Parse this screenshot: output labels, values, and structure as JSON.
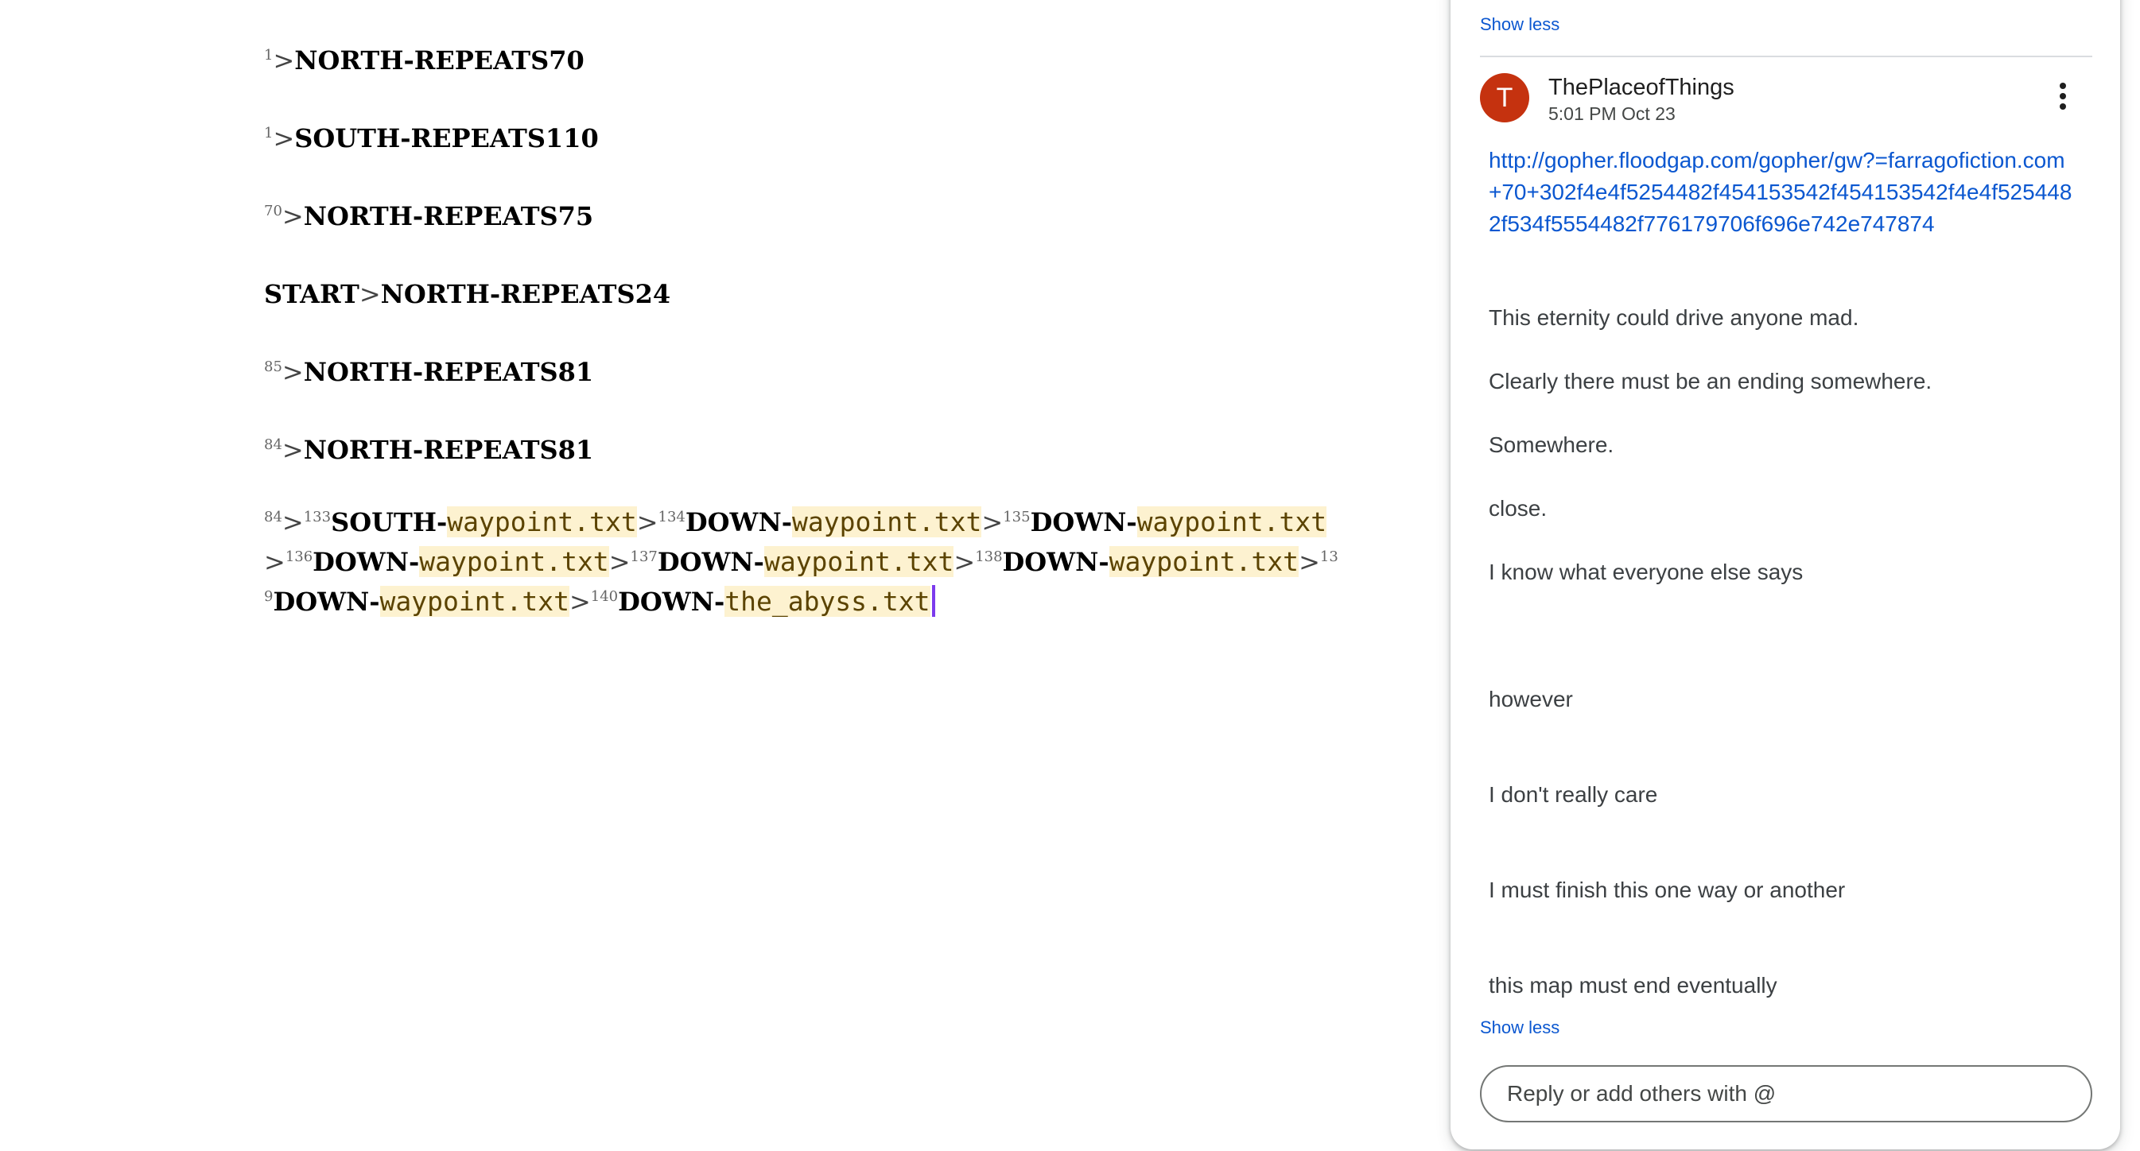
{
  "document": {
    "lines": [
      {
        "sup": "1",
        "gt": ">",
        "text": "NORTH-REPEATS70"
      },
      {
        "sup": "1",
        "gt": ">",
        "text": "SOUTH-REPEATS110"
      },
      {
        "sup": "70",
        "gt": ">",
        "text": "NORTH-REPEATS75"
      },
      {
        "prefix": "START",
        "gt": ">",
        "text": "NORTH-REPEATS24"
      },
      {
        "sup": "85",
        "gt": ">",
        "text": "NORTH-REPEATS81"
      },
      {
        "sup": "84",
        "gt": ">",
        "text": "NORTH-REPEATS81"
      }
    ],
    "waypoint_block": {
      "s84": "84",
      "s133": "133",
      "dir133": "SOUTH-",
      "f133": "waypoint.txt",
      "s134": "134",
      "dir134": "DOWN-",
      "f134": "waypoint.txt",
      "s135": "135",
      "dir135": "DOWN-",
      "f135": "waypoint.txt",
      "s136": "136",
      "dir136": "DOWN-",
      "f136": "waypoint.txt",
      "s137": "137",
      "dir137": "DOWN-",
      "f137": "waypoint.txt",
      "s138": "138",
      "dir138": "DOWN-",
      "f138": "waypoint.txt",
      "s139a": "13",
      "s139b": "9",
      "dir139": "DOWN-",
      "f139": "waypoint.txt",
      "s140": "140",
      "dir140": "DOWN-",
      "f140": "the_abyss.txt",
      "gt": ">"
    }
  },
  "comments": {
    "show_less_top": "Show less",
    "author": "ThePlaceofThings",
    "avatar_letter": "T",
    "timestamp": "5:01 PM Oct 23",
    "link": "http://gopher.floodgap.com/gopher/gw?=farragofiction.com+70+302f4e4f5254482f454153542f454153542f4e4f5254482f534f5554482f776179706f696e742e747874",
    "paragraphs": [
      "This eternity could drive anyone mad.",
      "Clearly there must be an ending somewhere.",
      "Somewhere.",
      "close.",
      "I know what everyone else says",
      "however",
      "I don't really care",
      "I must finish this one way or another",
      "this map must end eventually"
    ],
    "show_less_bottom": "Show less",
    "reply_placeholder": "Reply or add others with @"
  }
}
